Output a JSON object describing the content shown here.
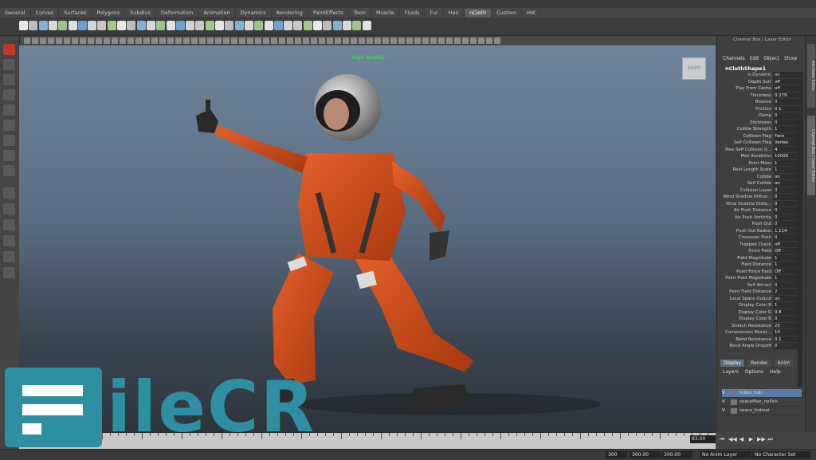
{
  "shelf": {
    "tabs": [
      "General",
      "Curves",
      "Surfaces",
      "Polygons",
      "Subdivs",
      "Deformation",
      "Animation",
      "Dynamics",
      "Rendering",
      "PaintEffects",
      "Toon",
      "Muscle",
      "Fluids",
      "Fur",
      "Hair",
      "nCloth",
      "Custom",
      "HIK"
    ],
    "active_tab": "nCloth"
  },
  "viewport": {
    "quality_label": "High Quality",
    "view_cube_label": "RIGHT"
  },
  "channel_box": {
    "title": "Channel Box / Layer Editor",
    "menu": [
      "Channels",
      "Edit",
      "Object",
      "Show"
    ],
    "node_name": "nClothShape1",
    "attributes": [
      {
        "label": "Is Dynamic",
        "value": "on"
      },
      {
        "label": "Depth Sort",
        "value": "off"
      },
      {
        "label": "Play From Cache",
        "value": "off"
      },
      {
        "label": "Thickness",
        "value": "0.279"
      },
      {
        "label": "Bounce",
        "value": "0"
      },
      {
        "label": "Friction",
        "value": "0.1"
      },
      {
        "label": "Damp",
        "value": "0"
      },
      {
        "label": "Stickiness",
        "value": "0"
      },
      {
        "label": "Collide Strength",
        "value": "1"
      },
      {
        "label": "Collision Flag",
        "value": "Face"
      },
      {
        "label": "Self Collision Flag",
        "value": "Vertex"
      },
      {
        "label": "Max Self Collision It...",
        "value": "4"
      },
      {
        "label": "Max Iterations",
        "value": "10000"
      },
      {
        "label": "Point Mass",
        "value": "1"
      },
      {
        "label": "Rest Length Scale",
        "value": "1"
      },
      {
        "label": "Collide",
        "value": "on"
      },
      {
        "label": "Self Collide",
        "value": "on"
      },
      {
        "label": "Collision Layer",
        "value": "0"
      },
      {
        "label": "Wind Shadow Diffusi...",
        "value": "0"
      },
      {
        "label": "Wind Shadow Dista...",
        "value": "0"
      },
      {
        "label": "Air Push Distance",
        "value": "0"
      },
      {
        "label": "Air Push Vorticity",
        "value": "0"
      },
      {
        "label": "Push Out",
        "value": "0"
      },
      {
        "label": "Push Out Radius",
        "value": "1.114"
      },
      {
        "label": "Crossover Push",
        "value": "0"
      },
      {
        "label": "Trapped Check",
        "value": "off"
      },
      {
        "label": "Force Field",
        "value": "Off"
      },
      {
        "label": "Field Magnitude",
        "value": "1"
      },
      {
        "label": "Field Distance",
        "value": "1"
      },
      {
        "label": "Point Force Field",
        "value": "Off"
      },
      {
        "label": "Point Field Magnitude",
        "value": "1"
      },
      {
        "label": "Self Attract",
        "value": "0"
      },
      {
        "label": "Point Field Distance",
        "value": "2"
      },
      {
        "label": "Local Space Output",
        "value": "on"
      },
      {
        "label": "Display Color R",
        "value": "1"
      },
      {
        "label": "Display Color G",
        "value": "0.8"
      },
      {
        "label": "Display Color B",
        "value": "0"
      },
      {
        "label": "Stretch Resistance",
        "value": "20"
      },
      {
        "label": "Compression Resist...",
        "value": "10"
      },
      {
        "label": "Bend Resistance",
        "value": "0.1"
      },
      {
        "label": "Bend Angle Dropoff",
        "value": "0"
      }
    ]
  },
  "layer_editor": {
    "tabs": [
      "Display",
      "Render",
      "Anim"
    ],
    "active_tab": "Display",
    "menu": [
      "Layers",
      "Options",
      "Help"
    ],
    "layers": [
      {
        "visible": "V",
        "name": "tubes_hair",
        "selected": true
      },
      {
        "visible": "V",
        "name": "spaceMan_noPick",
        "selected": false
      },
      {
        "visible": "V",
        "name": "space_helmet",
        "selected": false
      }
    ]
  },
  "side_tabs": [
    "Attribute Editor",
    "Channel Box / Layer Editor"
  ],
  "time": {
    "current_frame": "83.00",
    "range_start": "300",
    "range_end": "300.00",
    "range_end2": "300.00",
    "anim_layer": "No Anim Layer",
    "character_set": "No Character Set"
  },
  "watermark": {
    "text": "FileCR"
  },
  "colors": {
    "accent": "#5b7ba8",
    "watermark": "#2e8fa3",
    "suit": "#d4531e"
  }
}
